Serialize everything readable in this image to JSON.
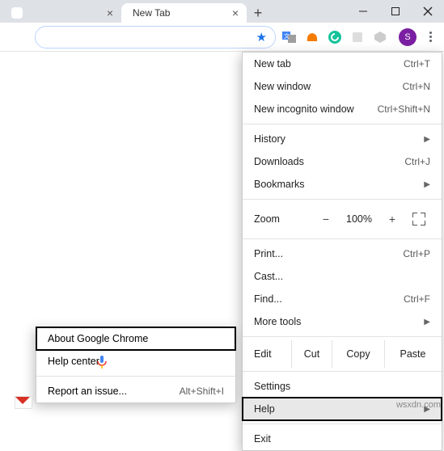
{
  "titlebar": {
    "tabs": [
      {
        "label": ""
      },
      {
        "label": "New Tab"
      }
    ]
  },
  "avatar_letter": "S",
  "menu": {
    "new_tab": "New tab",
    "new_tab_sc": "Ctrl+T",
    "new_window": "New window",
    "new_window_sc": "Ctrl+N",
    "new_incognito": "New incognito window",
    "new_incognito_sc": "Ctrl+Shift+N",
    "history": "History",
    "downloads": "Downloads",
    "downloads_sc": "Ctrl+J",
    "bookmarks": "Bookmarks",
    "zoom_label": "Zoom",
    "zoom_minus": "−",
    "zoom_value": "100%",
    "zoom_plus": "+",
    "print": "Print...",
    "print_sc": "Ctrl+P",
    "cast": "Cast...",
    "find": "Find...",
    "find_sc": "Ctrl+F",
    "more_tools": "More tools",
    "edit_label": "Edit",
    "cut": "Cut",
    "copy": "Copy",
    "paste": "Paste",
    "settings": "Settings",
    "help": "Help",
    "exit": "Exit"
  },
  "help_submenu": {
    "about": "About Google Chrome",
    "help_center": "Help center",
    "report": "Report an issue...",
    "report_sc": "Alt+Shift+I"
  },
  "watermark": "wsxdn.com"
}
